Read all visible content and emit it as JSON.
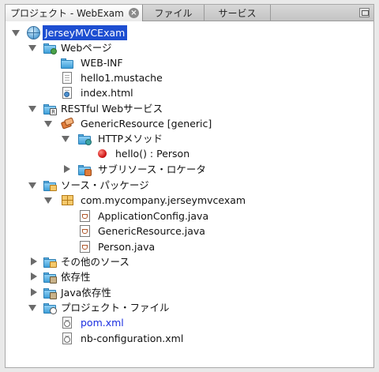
{
  "tabs": [
    {
      "label": "プロジェクト - WebExam",
      "active": true
    },
    {
      "label": "ファイル",
      "active": false
    },
    {
      "label": "サービス",
      "active": false
    }
  ],
  "tree": {
    "root": "JerseyMVCExam",
    "web_pages": "Webページ",
    "web_inf": "WEB-INF",
    "hello_mustache": "hello1.mustache",
    "index_html": "index.html",
    "restful_services": "RESTful Webサービス",
    "generic_resource": "GenericResource [generic]",
    "http_methods": "HTTPメソッド",
    "hello_method": "hello() : Person",
    "sub_resource_locators": "サブリソース・ロケータ",
    "source_packages": "ソース・パッケージ",
    "package_name": "com.mycompany.jerseymvcexam",
    "application_config": "ApplicationConfig.java",
    "generic_resource_java": "GenericResource.java",
    "person_java": "Person.java",
    "other_sources": "その他のソース",
    "dependencies": "依存性",
    "java_dependencies": "Java依存性",
    "project_files": "プロジェクト・ファイル",
    "pom_xml": "pom.xml",
    "nb_configuration": "nb-configuration.xml"
  },
  "colors": {
    "selection": "#1d4ed1",
    "link": "#1a2ee0"
  },
  "icons": {
    "tab_close": "close-icon",
    "restore": "restore-window-icon"
  }
}
